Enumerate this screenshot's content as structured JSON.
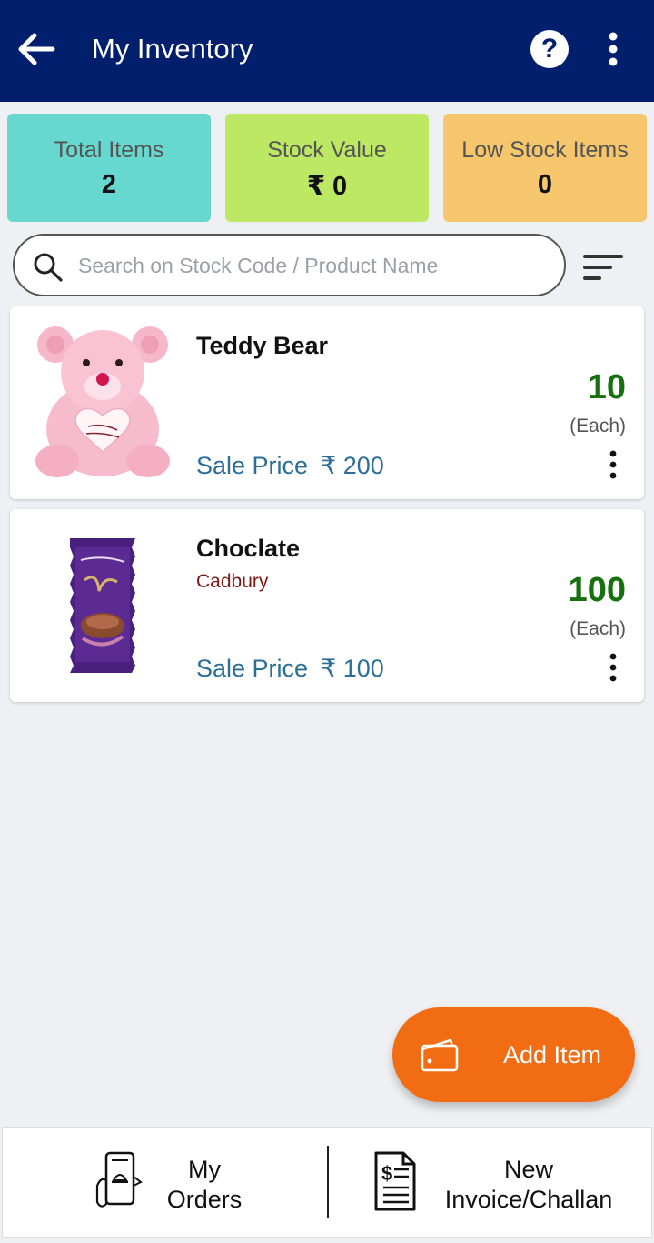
{
  "header": {
    "title": "My Inventory",
    "back_icon": "back-arrow-icon",
    "help_icon": "help-icon",
    "help_glyph": "?",
    "more_icon": "more-vert-icon"
  },
  "stats": [
    {
      "label": "Total Items",
      "value": "2",
      "color": "#66d8cf"
    },
    {
      "label": "Stock Value",
      "value": "₹ 0",
      "color": "#bde864"
    },
    {
      "label": "Low Stock Items",
      "value": "0",
      "color": "#f5c66c"
    }
  ],
  "search": {
    "placeholder": "Search on Stock Code / Product Name",
    "value": ""
  },
  "items": [
    {
      "name": "Teddy Bear",
      "brand": "",
      "price_label": "Sale Price",
      "price": "₹ 200",
      "quantity": "10",
      "unit": "(Each)"
    },
    {
      "name": "Choclate",
      "brand": "Cadbury",
      "price_label": "Sale Price",
      "price": "₹ 100",
      "quantity": "100",
      "unit": "(Each)"
    }
  ],
  "fab": {
    "label": "Add Item",
    "icon": "wallet-icon",
    "color": "#f26c14"
  },
  "bottom_nav": {
    "orders": {
      "line1": "My",
      "line2": "Orders",
      "icon": "mobile-orders-icon"
    },
    "invoice": {
      "line1": "New",
      "line2": "Invoice/Challan",
      "icon": "invoice-icon"
    }
  },
  "colors": {
    "appbar": "#021f6e",
    "quantity": "#16700e",
    "price": "#2c6e98",
    "brand": "#7a1a14"
  }
}
